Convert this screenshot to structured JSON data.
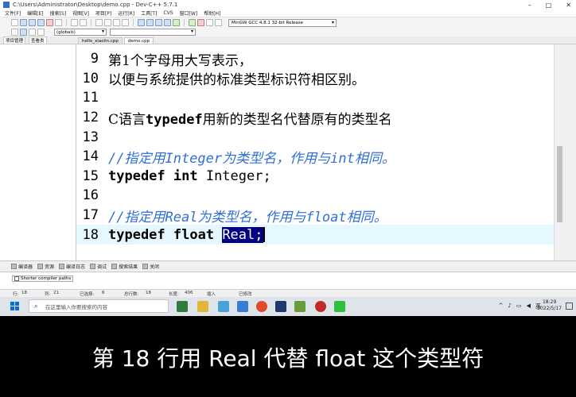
{
  "window": {
    "title": "C:\\Users\\Administrator\\Desktop\\demo.cpp - Dev-C++ 5.7.1"
  },
  "menu": [
    "文件[F]",
    "编辑[E]",
    "搜索[S]",
    "视图[V]",
    "项目[P]",
    "运行[R]",
    "工具[T]",
    "CVS",
    "窗口[W]",
    "帮助[H]"
  ],
  "toolbar": {
    "compiler": "MinGW GCC 4.8.1 32-bit Release",
    "scope": "(globals)"
  },
  "left_tabs": [
    "项目管理",
    "查看类"
  ],
  "file_tabs": [
    "hello_xiaolin.cpp",
    "demo.cpp"
  ],
  "code_lines": [
    {
      "num": "9",
      "text": "第1个字母用大写表示，"
    },
    {
      "num": "10",
      "text": "以便与系统提供的标准类型标识符相区别。"
    },
    {
      "num": "11",
      "text": ""
    },
    {
      "num": "12",
      "pre": "C语言",
      "kw": "typedef",
      "post": "用新的类型名代替原有的类型名"
    },
    {
      "num": "13",
      "text": ""
    },
    {
      "num": "14",
      "comment": "//指定用Integer为类型名，作用与int相同。"
    },
    {
      "num": "15",
      "kw": "typedef int",
      "post": " Integer;"
    },
    {
      "num": "16",
      "text": ""
    },
    {
      "num": "17",
      "comment": "//指定用Real为类型名，作用与float相同。"
    },
    {
      "num": "18",
      "kw": "typedef float",
      "selected": "Real;"
    }
  ],
  "bottom_tabs": [
    "编译器",
    "资源",
    "编译日志",
    "调试",
    "搜索结果",
    "关闭"
  ],
  "compiler_panel": {
    "checkbox": "Shorter compiler paths"
  },
  "status": {
    "row_label": "行:",
    "row": "18",
    "col_label": "列:",
    "col": "21",
    "sel_label": "已选择:",
    "sel": "6",
    "total_label": "总行数:",
    "total": "18",
    "len_label": "长度:",
    "len": "406",
    "mode": "插入",
    "modified": "已修改"
  },
  "taskbar": {
    "search_placeholder": "在这里输入你要搜索的内容",
    "ime": "英",
    "time": "18:29",
    "date": "2022/5/17"
  },
  "subtitle": "第 18 行用 Real 代替 float 这个类型符"
}
